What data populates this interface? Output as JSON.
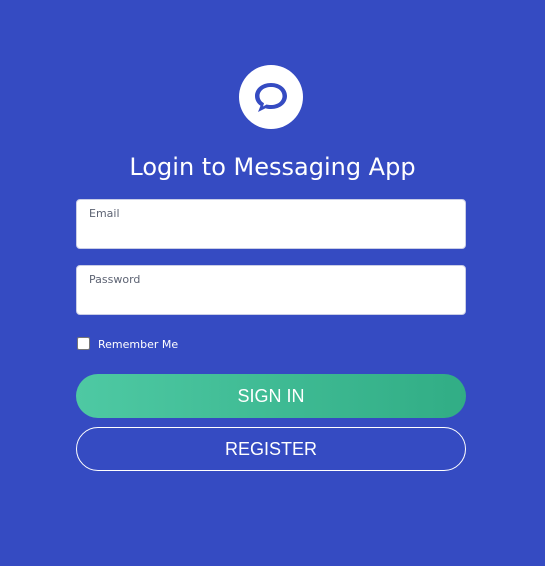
{
  "logo": {
    "icon": "chat-bubble-icon"
  },
  "title": "Login to Messaging App",
  "form": {
    "email": {
      "label": "Email",
      "value": ""
    },
    "password": {
      "label": "Password",
      "value": ""
    },
    "remember": {
      "label": "Remember Me",
      "checked": false
    }
  },
  "buttons": {
    "signin_label": "SIGN IN",
    "register_label": "REGISTER"
  },
  "colors": {
    "background": "#354bc2",
    "signin_gradient_start": "#4ec9a3",
    "signin_gradient_end": "#31ad85",
    "text": "#ffffff"
  }
}
